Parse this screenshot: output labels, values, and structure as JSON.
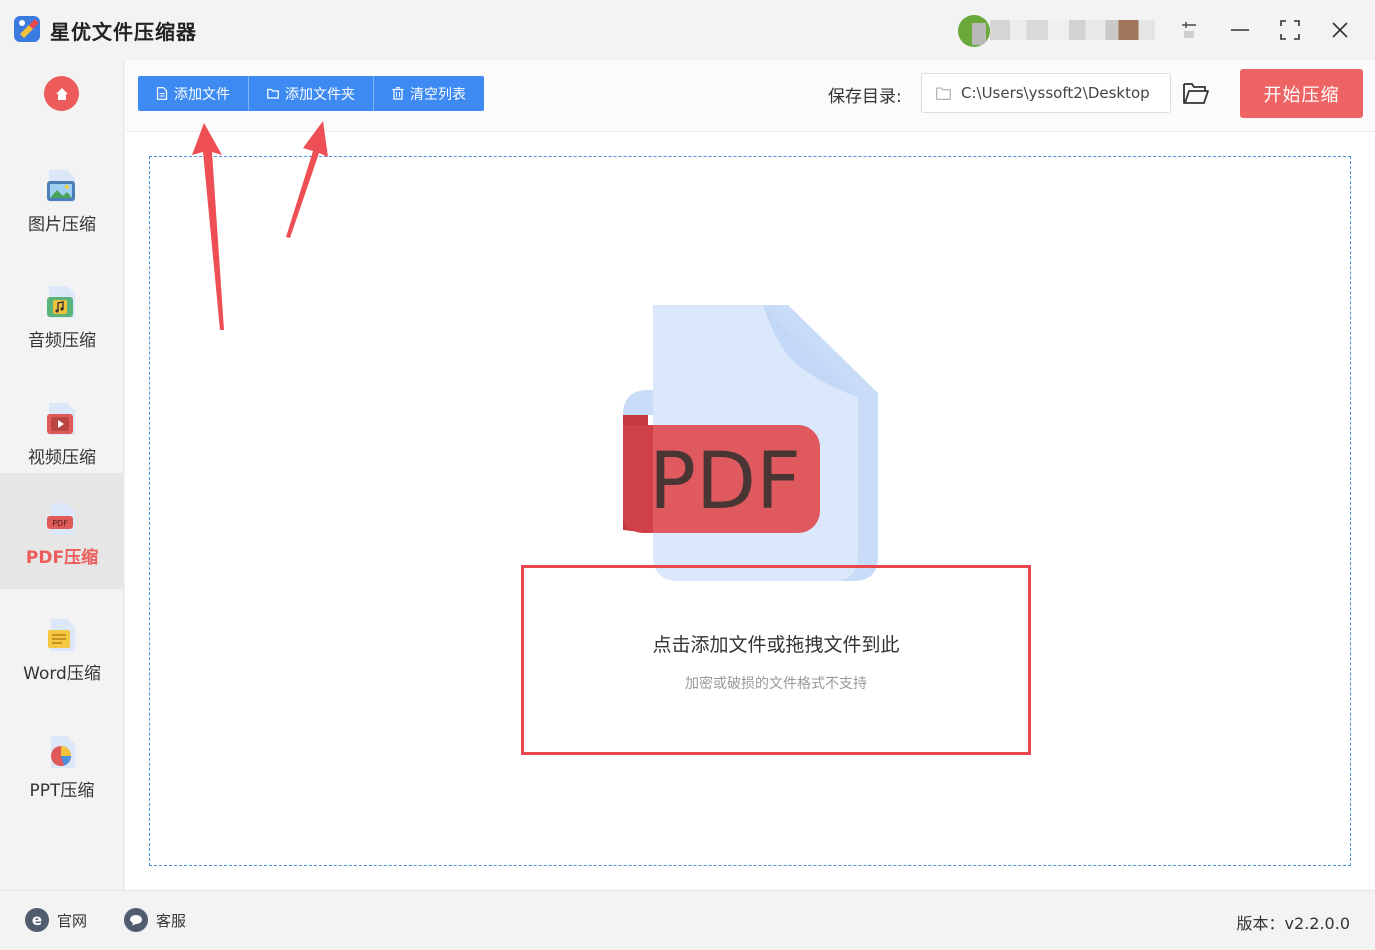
{
  "app": {
    "title": "星优文件压缩器",
    "accent": "#ee5b5b",
    "primary": "#3d8bf2"
  },
  "window": {
    "controls": [
      "pin-icon",
      "minimize-icon",
      "maximize-icon",
      "close-icon"
    ]
  },
  "sidebar": {
    "items": [
      {
        "label": "图片压缩",
        "icon": "image-icon"
      },
      {
        "label": "音频压缩",
        "icon": "audio-icon"
      },
      {
        "label": "视频压缩",
        "icon": "video-icon"
      },
      {
        "label": "PDF压缩",
        "icon": "pdf-icon",
        "active": true
      },
      {
        "label": "Word压缩",
        "icon": "word-icon"
      },
      {
        "label": "PPT压缩",
        "icon": "ppt-icon"
      }
    ]
  },
  "toolbar": {
    "add_file": "添加文件",
    "add_folder": "添加文件夹",
    "clear_list": "清空列表",
    "save_label": "保存目录:",
    "save_path": "C:\\Users\\yssoft2\\Desktop",
    "start": "开始压缩"
  },
  "dropzone": {
    "illustration_text": "PDF",
    "title": "点击添加文件或拖拽文件到此",
    "subtitle": "加密或破损的文件格式不支持"
  },
  "footer": {
    "website": "官网",
    "support": "客服",
    "version": "版本：v2.2.0.0"
  }
}
